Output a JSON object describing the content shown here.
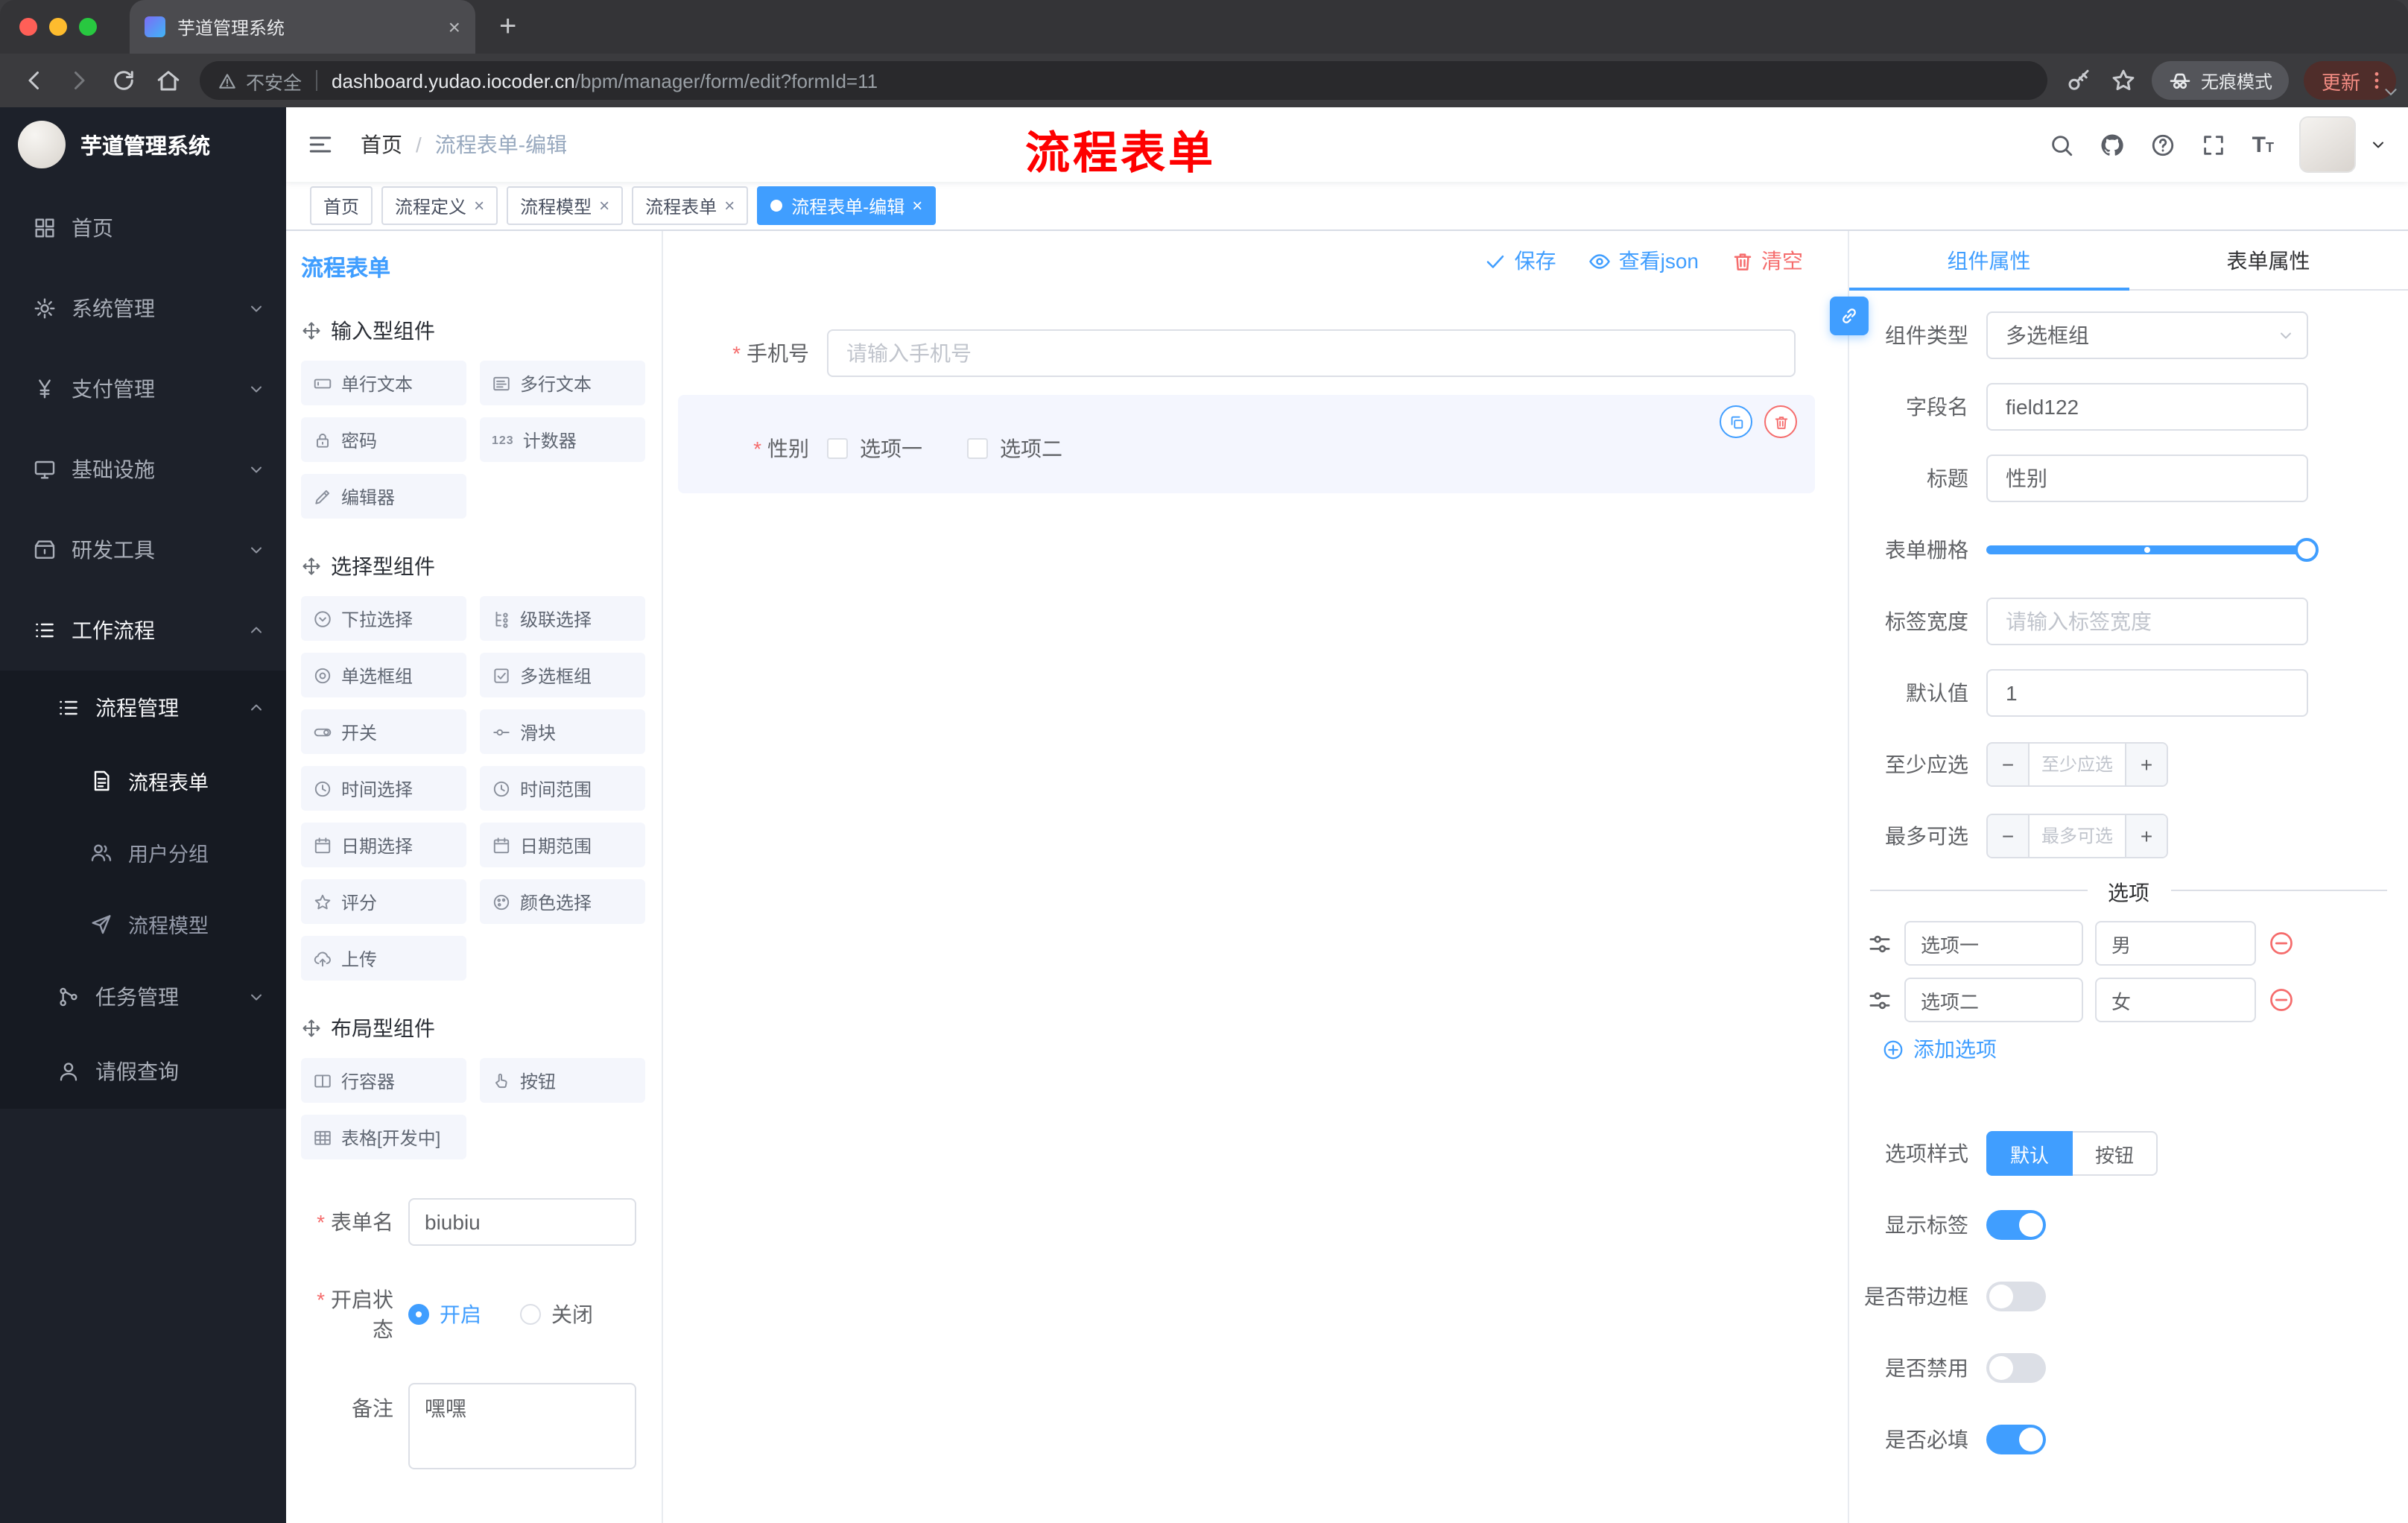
{
  "colors": {
    "accent": "#409eff",
    "danger": "#f56c6c"
  },
  "browser": {
    "tab_title": "芋道管理系统",
    "security_label": "不安全",
    "url_host": "dashboard.yudao.iocoder.cn",
    "url_path": "/bpm/manager/form/edit?formId=11",
    "incognito_label": "无痕模式",
    "update_label": "更新"
  },
  "sidebar": {
    "logo_title": "芋道管理系统",
    "menu": {
      "home": "首页",
      "system": "系统管理",
      "payment": "支付管理",
      "infra": "基础设施",
      "devtools": "研发工具",
      "workflow": "工作流程",
      "process_mgmt": "流程管理",
      "process_form": "流程表单",
      "user_group": "用户分组",
      "process_model": "流程模型",
      "task_mgmt": "任务管理",
      "leave_query": "请假查询"
    }
  },
  "header": {
    "breadcrumb_home": "首页",
    "breadcrumb_sep": "/",
    "breadcrumb_current": "流程表单-编辑",
    "annotation": "流程表单"
  },
  "tags": {
    "t0": "首页",
    "t1": "流程定义",
    "t2": "流程模型",
    "t3": "流程表单",
    "t4": "流程表单-编辑"
  },
  "palette": {
    "title": "流程表单",
    "group_input": "输入型组件",
    "group_select": "选择型组件",
    "group_layout": "布局型组件",
    "input_items": [
      "单行文本",
      "多行文本",
      "密码",
      "计数器",
      "编辑器"
    ],
    "select_items": [
      "下拉选择",
      "级联选择",
      "单选框组",
      "多选框组",
      "开关",
      "滑块",
      "时间选择",
      "时间范围",
      "日期选择",
      "日期范围",
      "评分",
      "颜色选择",
      "上传"
    ],
    "layout_items": [
      "行容器",
      "按钮",
      "表格[开发中]"
    ],
    "form": {
      "name_label": "表单名",
      "name_value": "biubiu",
      "status_label": "开启状态",
      "on_label": "开启",
      "off_label": "关闭",
      "remark_label": "备注",
      "remark_value": "嘿嘿"
    }
  },
  "canvas": {
    "save": "保存",
    "view_json": "查看json",
    "clear": "清空",
    "phone_label": "手机号",
    "phone_placeholder": "请输入手机号",
    "gender_label": "性别",
    "gender_opt1": "选项一",
    "gender_opt2": "选项二"
  },
  "inspector": {
    "tab_component": "组件属性",
    "tab_form": "表单属性",
    "type_label": "组件类型",
    "type_value": "多选框组",
    "field_label": "字段名",
    "field_value": "field122",
    "title_label": "标题",
    "title_value": "性别",
    "grid_label": "表单栅格",
    "labelw_label": "标签宽度",
    "labelw_placeholder": "请输入标签宽度",
    "default_label": "默认值",
    "default_value": "1",
    "min_label": "至少应选",
    "min_placeholder": "至少应选",
    "max_label": "最多可选",
    "max_placeholder": "最多可选",
    "options_title": "选项",
    "options": [
      {
        "label": "选项一",
        "value": "男"
      },
      {
        "label": "选项二",
        "value": "女"
      }
    ],
    "add_option": "添加选项",
    "style_label": "选项样式",
    "style_default": "默认",
    "style_button": "按钮",
    "toggle_show_label": "显示标签",
    "toggle_border": "是否带边框",
    "toggle_disabled": "是否禁用",
    "toggle_required": "是否必填"
  },
  "icons": {
    "header": [
      "search-icon",
      "github-icon",
      "help-icon",
      "fullscreen-icon",
      "font-size-icon"
    ],
    "canvas_actions": [
      "check-icon",
      "eye-icon",
      "trash-icon"
    ]
  }
}
